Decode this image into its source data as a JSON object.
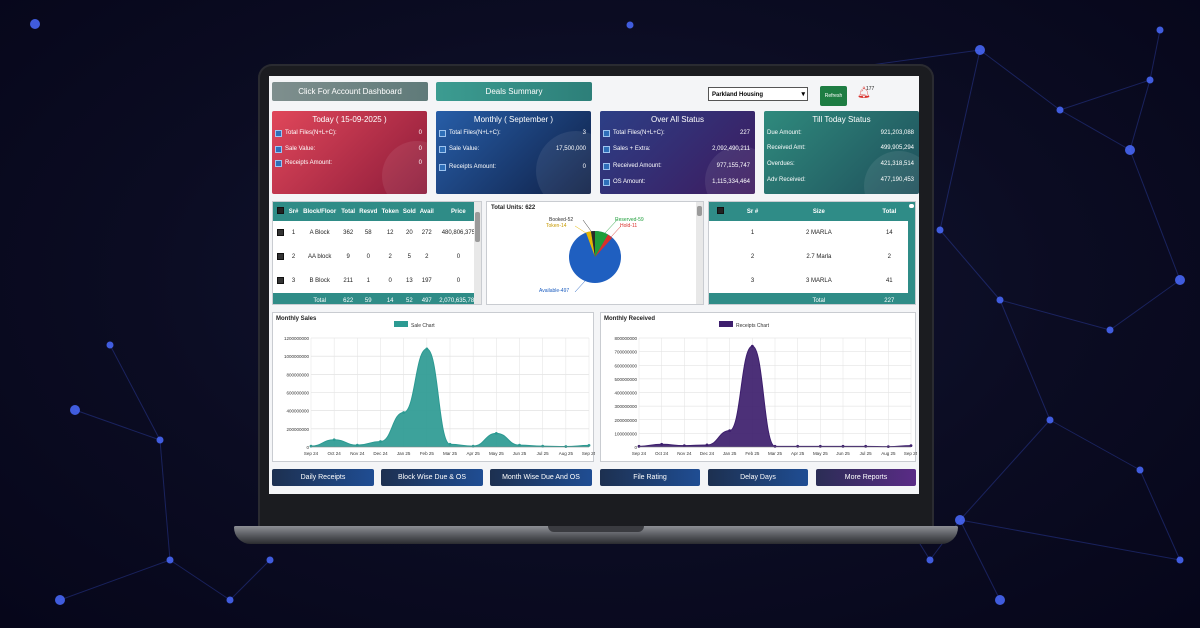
{
  "header": {
    "account_dashboard_label": "Click For Account Dashboard",
    "deals_summary_label": "Deals Summary",
    "project_select": "Parkland Housing",
    "refresh_label": "Refresh",
    "notification_count": "177"
  },
  "cards": {
    "today": {
      "title": "Today ( 15-09-2025 )",
      "rows": [
        {
          "label": "Total Files(N+L+C):",
          "value": "0"
        },
        {
          "label": "Sale Value:",
          "value": "0"
        },
        {
          "label": "Receipts Amount:",
          "value": "0"
        }
      ]
    },
    "monthly": {
      "title": "Monthly ( September )",
      "rows": [
        {
          "label": "Total Files(N+L+C):",
          "value": "3"
        },
        {
          "label": "Sale Value:",
          "value": "17,500,000"
        },
        {
          "label": "Receipts Amount:",
          "value": "0"
        }
      ]
    },
    "overall": {
      "title": "Over All Status",
      "rows": [
        {
          "label": "Total Files(N+L+C):",
          "value": "227"
        },
        {
          "label": "Sales + Extra:",
          "value": "2,092,490,211"
        },
        {
          "label": "Received Amount:",
          "value": "977,155,747"
        },
        {
          "label": "OS Amount:",
          "value": "1,115,334,464"
        }
      ]
    },
    "till_today": {
      "title": "Till Today Status",
      "rows": [
        {
          "label": "Due Amount:",
          "value": "921,203,088"
        },
        {
          "label": "Received Amt:",
          "value": "499,905,294"
        },
        {
          "label": "Overdues:",
          "value": "421,318,514"
        },
        {
          "label": "Adv Received:",
          "value": "477,190,453"
        }
      ]
    }
  },
  "block_table": {
    "headers": [
      "",
      "Sr#",
      "Block/Floor",
      "Total",
      "Resvd",
      "Token",
      "Sold",
      "Avail",
      "Price"
    ],
    "rows": [
      [
        "1",
        "A Block",
        "362",
        "58",
        "12",
        "20",
        "272",
        "480,806,375"
      ],
      [
        "2",
        "AA block",
        "9",
        "0",
        "2",
        "5",
        "2",
        "0"
      ],
      [
        "3",
        "B Block",
        "211",
        "1",
        "0",
        "13",
        "197",
        "0"
      ]
    ],
    "total": [
      "Total",
      "622",
      "59",
      "14",
      "52",
      "497",
      "2,070,635,789"
    ]
  },
  "units_pie": {
    "title": "Total Units: 622",
    "labels": {
      "booked": "Booked-52",
      "token": "Token-14",
      "reserved": "Reserved-59",
      "hold": "Hold-11",
      "available": "Available-497"
    }
  },
  "size_table": {
    "headers": [
      "",
      "Sr #",
      "Size",
      "Total"
    ],
    "rows": [
      [
        "1",
        "2 MARLA",
        "14"
      ],
      [
        "2",
        "2.7 Marla",
        "2"
      ],
      [
        "3",
        "3 MARLA",
        "41"
      ]
    ],
    "total": [
      "Total",
      "227"
    ]
  },
  "chart_data": [
    {
      "type": "area",
      "title": "Monthly Sales",
      "series": [
        {
          "name": "Sale Chart",
          "color": "#2c9a92"
        }
      ],
      "x_ticks": [
        "Sep 24",
        "Oct 24",
        "Nov 24",
        "Dec 24",
        "Jan 25",
        "Feb 25",
        "Mar 25",
        "Apr 25",
        "May 25",
        "Jun 25",
        "Jul 25",
        "Aug 25",
        "Sep 25"
      ],
      "y_ticks": [
        "0",
        "200000000",
        "400000000",
        "600000000",
        "800000000",
        "1000000000",
        "1200000000"
      ],
      "ylim": [
        0,
        1200000000
      ],
      "values": [
        10000000,
        80000000,
        20000000,
        60000000,
        380000000,
        1080000000,
        30000000,
        10000000,
        150000000,
        20000000,
        10000000,
        5000000,
        17500000
      ],
      "grid": true
    },
    {
      "type": "area",
      "title": "Monthly Received",
      "series": [
        {
          "name": "Receipts Chart",
          "color": "#3d1e6d"
        }
      ],
      "x_ticks": [
        "Sep 24",
        "Oct 24",
        "Nov 24",
        "Dec 24",
        "Jan 25",
        "Feb 25",
        "Mar 25",
        "Apr 25",
        "May 25",
        "Jun 25",
        "Jul 25",
        "Aug 25",
        "Sep 25"
      ],
      "y_ticks": [
        "0",
        "100000000",
        "200000000",
        "300000000",
        "400000000",
        "500000000",
        "600000000",
        "700000000",
        "800000000"
      ],
      "ylim": [
        0,
        800000000
      ],
      "values": [
        5000000,
        20000000,
        10000000,
        15000000,
        120000000,
        740000000,
        5000000,
        5000000,
        5000000,
        5000000,
        5000000,
        3000000,
        10000000
      ],
      "grid": true
    }
  ],
  "footer_buttons": [
    "Daily Receipts",
    "Block Wise Due & OS",
    "Month Wise Due And OS",
    "File Rating",
    "Delay Days",
    "More Reports"
  ]
}
